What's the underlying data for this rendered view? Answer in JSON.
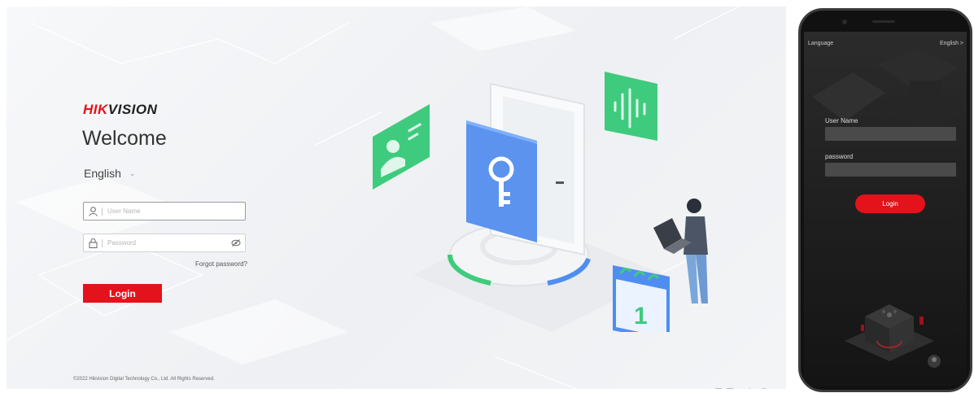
{
  "desktop": {
    "brand": {
      "part1": "HIK",
      "part2": "VISION"
    },
    "welcome": "Welcome",
    "language": "English",
    "username_placeholder": "User Name",
    "password_placeholder": "Password",
    "forgot": "Forgot password?",
    "login": "Login",
    "copyright": "©2022 Hikvision Digital Technology Co., Ltd. All Rights Reserved.",
    "calendar_day": "1"
  },
  "phone": {
    "language_label": "Language",
    "language_value": "English >",
    "username_label": "User Name",
    "password_label": "password",
    "login": "Login"
  },
  "colors": {
    "brand_red": "#e3121b",
    "accent_green": "#3ecb7d",
    "accent_blue": "#4f8ef0"
  }
}
